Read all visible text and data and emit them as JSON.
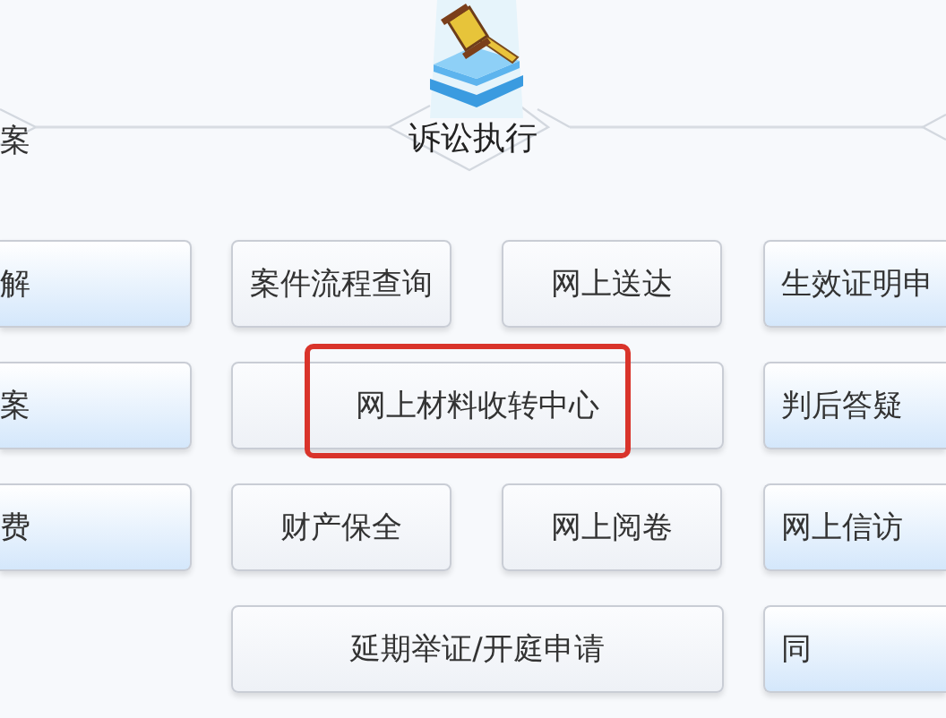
{
  "left_section_title": "案",
  "section": {
    "title": "诉讼执行"
  },
  "rows": [
    {
      "left": {
        "label": "解"
      },
      "center": [
        {
          "label": "案件流程查询",
          "highlighted": false
        },
        {
          "label": "网上送达",
          "highlighted": false
        }
      ],
      "right": {
        "label": "生效证明申"
      }
    },
    {
      "left": {
        "label": "案"
      },
      "center": [
        {
          "label": "网上材料收转中心",
          "highlighted": true
        }
      ],
      "right": {
        "label": "判后答疑"
      }
    },
    {
      "left": {
        "label": "费"
      },
      "center": [
        {
          "label": "财产保全",
          "highlighted": false
        },
        {
          "label": "网上阅卷",
          "highlighted": false
        }
      ],
      "right": {
        "label": "网上信访"
      }
    },
    {
      "center": [
        {
          "label": "延期举证/开庭申请",
          "highlighted": false
        }
      ],
      "right": {
        "label": "同"
      }
    }
  ]
}
